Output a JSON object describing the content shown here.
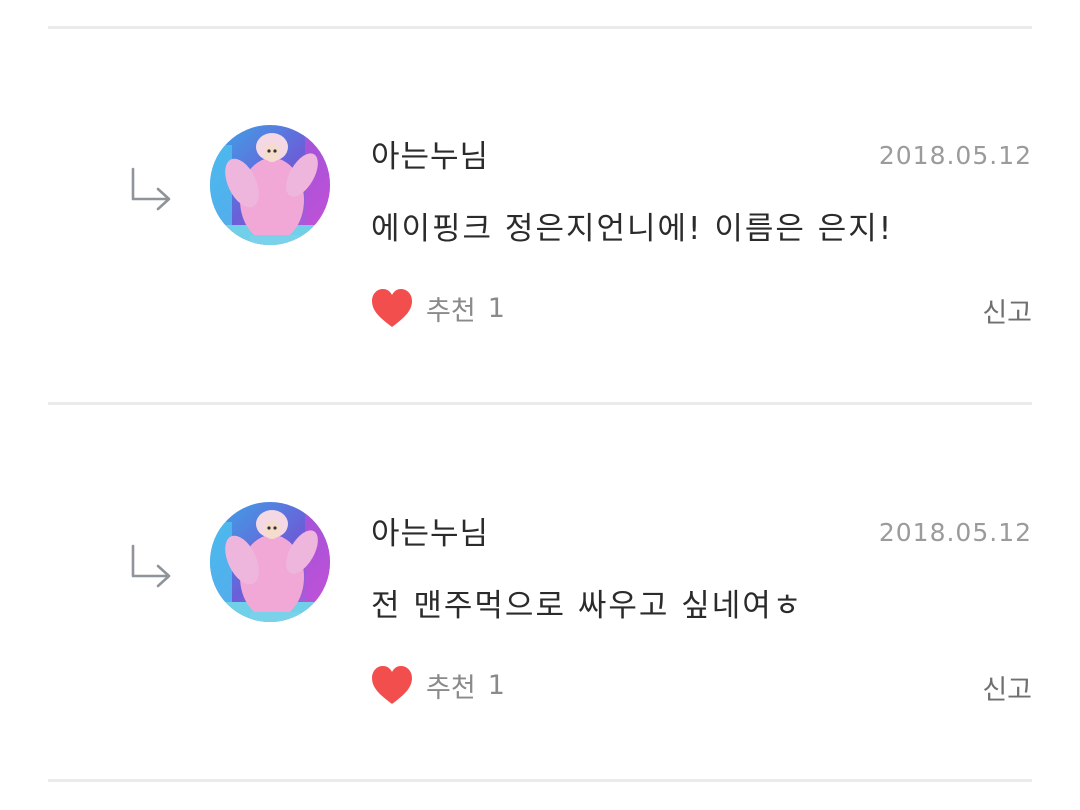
{
  "comments": [
    {
      "author": "아는누님",
      "date": "2018.05.12",
      "text": "에이핑크 정은지언니에! 이름은 은지!",
      "like_label": "추천",
      "like_count": "1",
      "report_label": "신고",
      "icons": {
        "reply": "reply-arrow-icon",
        "like": "heart-icon",
        "avatar": "avatar-photo"
      }
    },
    {
      "author": "아는누님",
      "date": "2018.05.12",
      "text": "전 맨주먹으로 싸우고 싶네여ㅎ",
      "like_label": "추천",
      "like_count": "1",
      "report_label": "신고",
      "icons": {
        "reply": "reply-arrow-icon",
        "like": "heart-icon",
        "avatar": "avatar-photo"
      }
    }
  ],
  "colors": {
    "heart": "#f24e4e",
    "divider": "#ebebeb",
    "author_text": "#2b2b2b",
    "meta_text": "#9b9b9b"
  }
}
